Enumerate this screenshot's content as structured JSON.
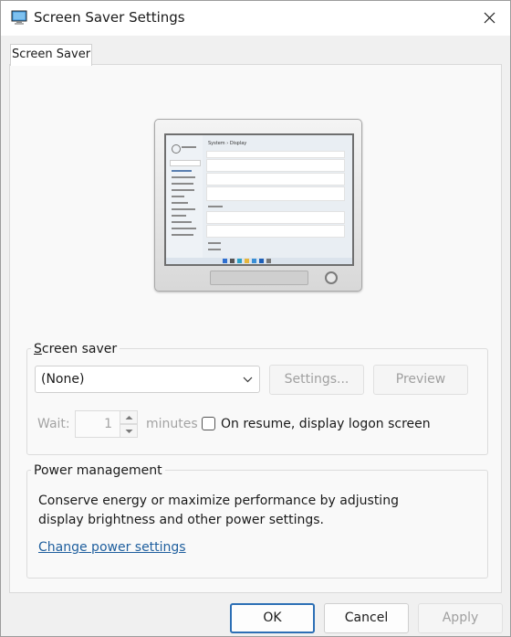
{
  "window": {
    "title": "Screen Saver Settings"
  },
  "tabs": [
    {
      "label": "Screen Saver"
    }
  ],
  "preview_monitor": {
    "screen_breadcrumb": "System › Display",
    "taskbar_icons": [
      "start",
      "search",
      "edge",
      "explorer",
      "store",
      "mail",
      "settings"
    ]
  },
  "screen_saver_group": {
    "label": "Screen saver",
    "selected": "(None)",
    "settings_button": "Settings...",
    "preview_button": "Preview",
    "wait_label": "Wait:",
    "wait_value": "1",
    "minutes_label": "minutes",
    "logon_checkbox_label": "On resume, display logon screen",
    "logon_checked": false
  },
  "power_group": {
    "label": "Power management",
    "description": "Conserve energy or maximize performance by adjusting display brightness and other power settings.",
    "link": "Change power settings"
  },
  "footer": {
    "ok": "OK",
    "cancel": "Cancel",
    "apply": "Apply"
  },
  "colors": {
    "accent": "#2c6fb5",
    "link": "#1f5f9e",
    "disabled_text": "#a0a0a0"
  }
}
